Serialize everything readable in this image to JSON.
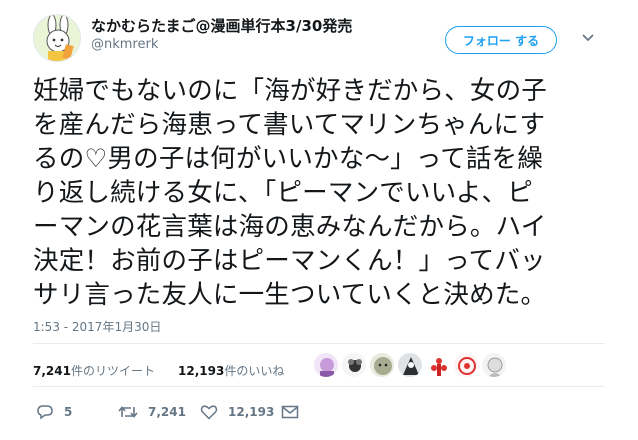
{
  "author": {
    "display_name": "なかむらたまご@漫画単行本3/30発売",
    "handle": "@nkmrerk"
  },
  "follow_button": {
    "label": "フォロー する"
  },
  "tweet": {
    "text": "妊婦でもないのに「海が好きだから、女の子\nを産んだら海恵って書いてマリンちゃんにす\nるの♡男の子は何がいいかな〜」って話を繰\nり返し続ける女に、「ピーマンでいいよ、ピ\nーマンの花言葉は海の恵みなんだから。ハイ\n決定！お前の子はピーマンくん！」ってバッ\nサリ言った友人に一生ついていくと決めた。",
    "timestamp": "1:53 - 2017年1月30日"
  },
  "stats": {
    "retweets_count": "7,241",
    "retweets_label": "件のリツイート",
    "likes_count": "12,193",
    "likes_label": "件のいいね"
  },
  "liker_avatars": [
    "avatar-1",
    "avatar-2",
    "avatar-3",
    "avatar-4",
    "avatar-5",
    "avatar-6",
    "avatar-7"
  ],
  "actions": {
    "reply_count": "5",
    "retweet_count": "7,241",
    "like_count": "12,193"
  },
  "colors": {
    "accent": "#1da1f2",
    "text": "#14171a",
    "muted": "#657786",
    "divider": "#e6ecf0"
  }
}
